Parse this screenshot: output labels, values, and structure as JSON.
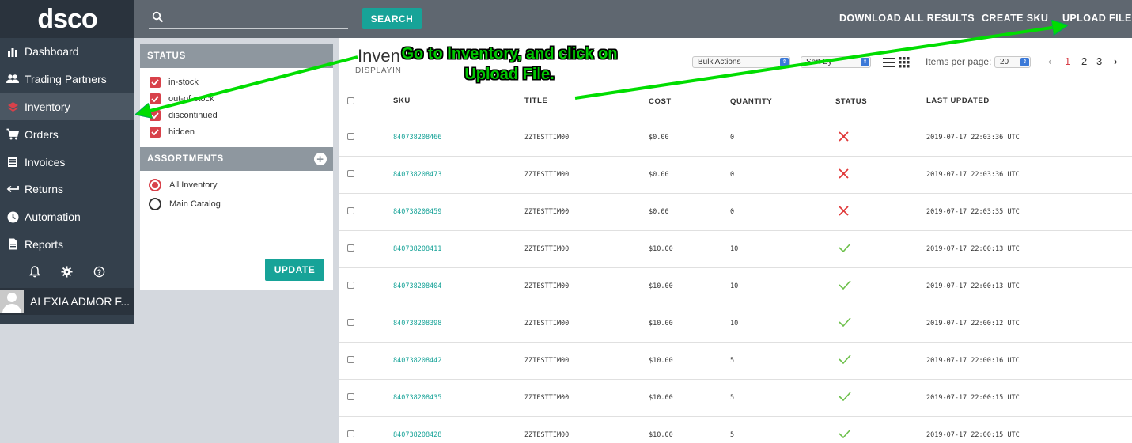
{
  "sidebar": {
    "logo": "dsco",
    "items": [
      {
        "label": "Dashboard",
        "icon": "bar-chart-icon"
      },
      {
        "label": "Trading Partners",
        "icon": "people-icon"
      },
      {
        "label": "Inventory",
        "icon": "layers-icon",
        "active": true
      },
      {
        "label": "Orders",
        "icon": "cart-icon"
      },
      {
        "label": "Invoices",
        "icon": "invoice-icon"
      },
      {
        "label": "Returns",
        "icon": "return-arrow-icon"
      },
      {
        "label": "Automation",
        "icon": "clock-icon"
      },
      {
        "label": "Reports",
        "icon": "document-icon"
      }
    ],
    "utility_icons": [
      "bell-icon",
      "gear-icon",
      "help-icon"
    ],
    "user_name": "ALEXIA ADMOR F..."
  },
  "topbar": {
    "search_placeholder": "",
    "search_label": "SEARCH",
    "download_all": "DOWNLOAD ALL RESULTS",
    "create_sku": "CREATE SKU",
    "upload_file": "UPLOAD FILE"
  },
  "status_panel": {
    "header": "STATUS",
    "options": [
      "in-stock",
      "out-of-stock",
      "discontinued",
      "hidden"
    ],
    "visible_labels": [
      "in-stock",
      "...-stock",
      "discontinued",
      "hidden"
    ]
  },
  "assortments_panel": {
    "header": "ASSORTMENTS",
    "options": [
      "All Inventory",
      "Main Catalog"
    ],
    "selected": "All Inventory",
    "update_label": "UPDATE"
  },
  "main": {
    "title": "Inven",
    "displaying": "DISPLAYIN",
    "bulk_actions": "Bulk Actions",
    "sort_by": "Sort By",
    "items_per_page_label": "Items per page:",
    "items_per_page": "20",
    "pages": [
      "1",
      "2",
      "3"
    ],
    "current_page": "1"
  },
  "table": {
    "columns": [
      "SKU",
      "TITLE",
      "COST",
      "QUANTITY",
      "STATUS",
      "LAST UPDATED"
    ],
    "rows": [
      {
        "sku": "840738208466",
        "title": "ZZTESTTIM00",
        "cost": "$0.00",
        "qty": "0",
        "status": "inactive",
        "updated": "2019-07-17 22:03:36 UTC"
      },
      {
        "sku": "840738208473",
        "title": "ZZTESTTIM00",
        "cost": "$0.00",
        "qty": "0",
        "status": "inactive",
        "updated": "2019-07-17 22:03:36 UTC"
      },
      {
        "sku": "840738208459",
        "title": "ZZTESTTIM00",
        "cost": "$0.00",
        "qty": "0",
        "status": "inactive",
        "updated": "2019-07-17 22:03:35 UTC"
      },
      {
        "sku": "840738208411",
        "title": "ZZTESTTIM00",
        "cost": "$10.00",
        "qty": "10",
        "status": "active",
        "updated": "2019-07-17 22:00:13 UTC"
      },
      {
        "sku": "840738208404",
        "title": "ZZTESTTIM00",
        "cost": "$10.00",
        "qty": "10",
        "status": "active",
        "updated": "2019-07-17 22:00:13 UTC"
      },
      {
        "sku": "840738208398",
        "title": "ZZTESTTIM00",
        "cost": "$10.00",
        "qty": "10",
        "status": "active",
        "updated": "2019-07-17 22:00:12 UTC"
      },
      {
        "sku": "840738208442",
        "title": "ZZTESTTIM00",
        "cost": "$10.00",
        "qty": "5",
        "status": "active",
        "updated": "2019-07-17 22:00:16 UTC"
      },
      {
        "sku": "840738208435",
        "title": "ZZTESTTIM00",
        "cost": "$10.00",
        "qty": "5",
        "status": "active",
        "updated": "2019-07-17 22:00:15 UTC"
      },
      {
        "sku": "840738208428",
        "title": "ZZTESTTIM00",
        "cost": "$10.00",
        "qty": "5",
        "status": "active",
        "updated": "2019-07-17 22:00:15 UTC"
      }
    ]
  },
  "annotation": {
    "text": "Go to Inventory, and click on Upload File.",
    "color": "#00c800"
  },
  "colors": {
    "accent": "#17a398",
    "checkbox_red": "#d8414a",
    "sidebar_bg": "#34404c",
    "topbar_bg": "#5f6770"
  }
}
